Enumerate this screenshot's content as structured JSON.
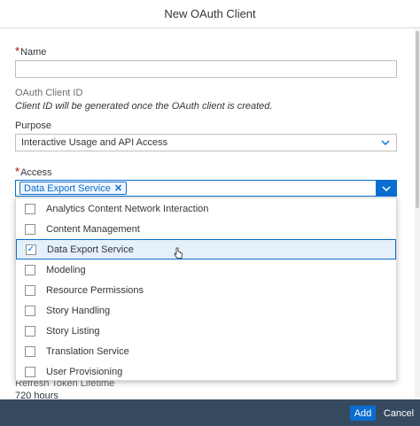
{
  "dialog": {
    "title": "New OAuth Client"
  },
  "name": {
    "label": "Name",
    "value": ""
  },
  "client_id": {
    "label": "OAuth Client ID",
    "note": "Client ID will be generated once the OAuth client is created."
  },
  "purpose": {
    "label": "Purpose",
    "value": "Interactive Usage and API Access"
  },
  "access": {
    "label": "Access",
    "token": "Data Export Service",
    "options": [
      {
        "label": "Analytics Content Network Interaction",
        "checked": false
      },
      {
        "label": "Content Management",
        "checked": false
      },
      {
        "label": "Data Export Service",
        "checked": true
      },
      {
        "label": "Modeling",
        "checked": false
      },
      {
        "label": "Resource Permissions",
        "checked": false
      },
      {
        "label": "Story Handling",
        "checked": false
      },
      {
        "label": "Story Listing",
        "checked": false
      },
      {
        "label": "Translation Service",
        "checked": false
      },
      {
        "label": "User Provisioning",
        "checked": false
      }
    ]
  },
  "refresh_token": {
    "label": "Refresh Token Lifetime",
    "value": "720 hours"
  },
  "footer": {
    "add_label": "Add",
    "cancel_label": "Cancel"
  },
  "colors": {
    "accent": "#0a6ed1",
    "footer_bg": "#354a5f",
    "required": "#bb0000"
  },
  "icons": {
    "token_remove": "close-icon",
    "dropdown": "chevron-down-icon",
    "check": "check-icon",
    "pointer": "hand-cursor-icon"
  }
}
